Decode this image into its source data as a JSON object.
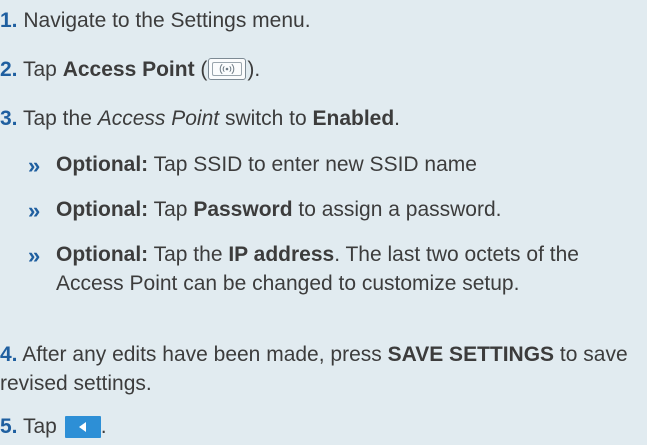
{
  "steps": [
    {
      "num": "1.",
      "text": "Navigate to the Settings menu."
    },
    {
      "num": "2.",
      "pre": "Tap ",
      "bold": "Access Point",
      "open": " (",
      "close": ").",
      "icon": "access-point-wifi-icon"
    },
    {
      "num": "3.",
      "pre": "Tap the ",
      "italic": "Access Point",
      "mid": " switch to ",
      "bold": "Enabled",
      "post": "."
    },
    {
      "num": "4.",
      "pre": "After any edits have been made, press ",
      "bold": "SAVE SETTINGS",
      "post": " to save revised settings."
    },
    {
      "num": "5.",
      "pre": "Tap ",
      "post": ".",
      "icon": "back-arrow-icon"
    }
  ],
  "substeps": [
    {
      "marker": "»",
      "label": "Optional:",
      "text": " Tap SSID to enter new SSID name"
    },
    {
      "marker": "»",
      "label": "Optional:",
      "pre": " Tap ",
      "bold": "Password",
      "post": " to assign a password."
    },
    {
      "marker": "»",
      "label": "Optional:",
      "pre": " Tap the ",
      "bold": "IP address",
      "post": ". The last two octets of the Access Point can be changed to customize setup."
    }
  ],
  "colors": {
    "background": "#e1ebf0",
    "step_number": "#1f5fa0",
    "back_button": "#2d8fd6",
    "text": "#3c3c3c"
  }
}
